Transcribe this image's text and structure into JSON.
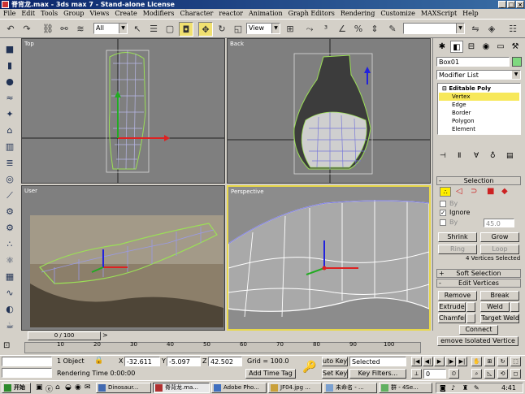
{
  "window": {
    "title": "脊背龙.max - 3ds max 7 - Stand-alone License"
  },
  "menu": [
    "File",
    "Edit",
    "Tools",
    "Group",
    "Views",
    "Create",
    "Modifiers",
    "Character",
    "reactor",
    "Animation",
    "Graph Editors",
    "Rendering",
    "Customize",
    "MAXScript",
    "Help"
  ],
  "toolbar": {
    "selection_filter": "All",
    "ref_coord": "View"
  },
  "viewports": {
    "top": "Top",
    "back": "Back",
    "user": "User",
    "perspective": "Perspective"
  },
  "panel": {
    "object_name": "Box01",
    "modifier_list": "Modifier List",
    "stack": {
      "root": "Editable Poly",
      "items": [
        "Vertex",
        "Edge",
        "Border",
        "Polygon",
        "Element"
      ]
    },
    "selection": {
      "title": "Selection",
      "by_vertex": "By",
      "ignore_backfacing": "Ignore",
      "by_angle": "By",
      "angle_value": "45.0",
      "shrink": "Shrink",
      "grow": "Grow",
      "ring": "Ring",
      "loop": "Loop",
      "status": "4 Vertices Selected"
    },
    "soft_selection": {
      "title": "Soft Selection"
    },
    "edit_vertices": {
      "title": "Edit Vertices",
      "remove": "Remove",
      "break": "Break",
      "extrude": "Extrude",
      "weld": "Weld",
      "chamfer": "Chamfer",
      "target_weld": "Target Weld",
      "connect": "Connect",
      "remove_isolated": "emove Isolated Vertice"
    }
  },
  "timeline": {
    "frame": "0 / 100",
    "ticks": [
      "10",
      "20",
      "30",
      "40",
      "50",
      "60",
      "70",
      "80",
      "90",
      "100"
    ]
  },
  "status": {
    "objects": "1 Object",
    "x_label": "X",
    "x_value": "-32.611",
    "y_label": "Y",
    "y_value": "-5.097",
    "z_label": "Z",
    "z_value": "42.502",
    "grid": "Grid = 100.0",
    "rendering_time": "Rendering Time  0:00:00",
    "add_time_tag": "Add Time Tag",
    "auto_key": "uto Key",
    "set_key": "Set Key",
    "key_mode": "Selected",
    "key_filters": "Key Filters...",
    "frame_field": "0"
  },
  "taskbar": {
    "start": "开始",
    "tasks": [
      "Dinosaur...",
      "脊背龙.ma...",
      "Adobe Pho...",
      "JF04.jpg ...",
      "未命名 - ..."
    ],
    "tray_text": "群 - 4Se...",
    "clock": "4:41"
  },
  "colors": {
    "title_gradient_start": "#0a246a",
    "title_gradient_end": "#3a6ea5",
    "active_viewport": "#e8d84a",
    "stack_selected": "#f7e85a"
  }
}
